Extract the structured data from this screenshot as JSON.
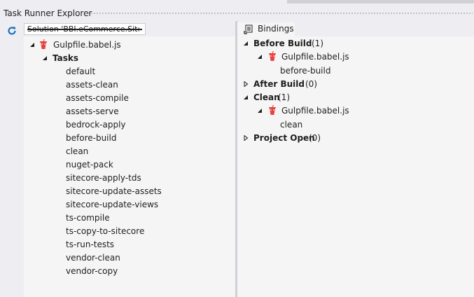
{
  "window": {
    "title": "Task Runner Explorer"
  },
  "toolbar": {
    "refresh_icon": "refresh-icon"
  },
  "solution_combo": {
    "value": "Solution 'BBI.eCommerce.Site'"
  },
  "left_tree": {
    "file": {
      "label": "Gulpfile.babel.js",
      "icon": "gulp-icon"
    },
    "tasks_header": "Tasks",
    "tasks": [
      "default",
      "assets-clean",
      "assets-compile",
      "assets-serve",
      "bedrock-apply",
      "before-build",
      "clean",
      "nuget-pack",
      "sitecore-apply-tds",
      "sitecore-update-assets",
      "sitecore-update-views",
      "ts-compile",
      "ts-copy-to-sitecore",
      "ts-run-tests",
      "vendor-clean",
      "vendor-copy"
    ]
  },
  "bindings": {
    "tab_label": "Bindings",
    "groups": [
      {
        "name": "Before Build",
        "count": "(1)",
        "file": "Gulpfile.babel.js",
        "task": "before-build"
      },
      {
        "name": "After Build",
        "count": "(0)"
      },
      {
        "name": "Clean",
        "count": "(1)",
        "file": "Gulpfile.babel.js",
        "task": "clean"
      },
      {
        "name": "Project Open",
        "count": "(0)"
      }
    ]
  },
  "colors": {
    "gulp_red": "#e8423e",
    "arrow": "#1e1e1e",
    "panel_bg": "#f5f5f5",
    "chrome_bg": "#eeeef2"
  }
}
